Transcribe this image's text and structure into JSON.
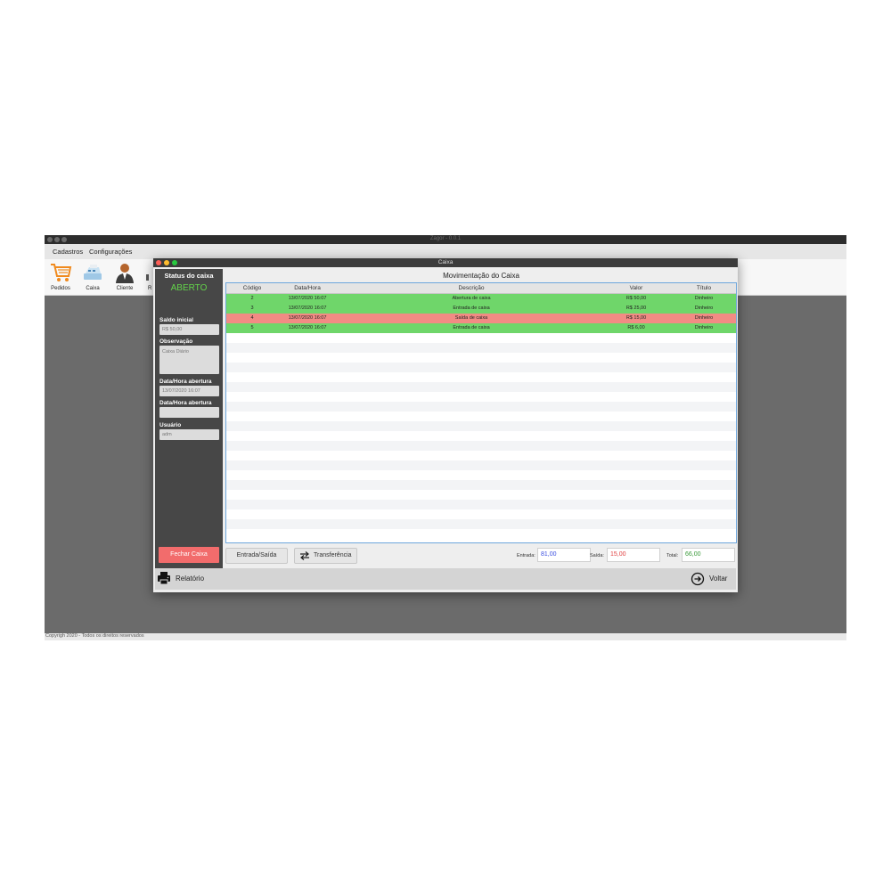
{
  "app": {
    "title": "Zagor - 0.0.1",
    "menu": [
      "Cadastros",
      "Configurações"
    ],
    "toolbar": [
      {
        "label": "Pedidos",
        "icon": "shopping-cart-icon"
      },
      {
        "label": "Caixa",
        "icon": "cash-register-icon"
      },
      {
        "label": "Cliente",
        "icon": "user-icon"
      }
    ],
    "partial_toolbar_label": "R",
    "copyright": "Copyrigh 2020 - Todos os direitos reservados"
  },
  "dialog": {
    "title": "Caixa",
    "side": {
      "status_label": "Status do caixa",
      "status_value": "ABERTO",
      "saldo_label": "Saldo inicial",
      "saldo_value": "R$ 50,00",
      "obs_label": "Observação",
      "obs_value": "Caixa Diário",
      "abertura_label": "Data/Hora abertura",
      "abertura_value": "13/07/2020 16:07",
      "fechamento_label": "Data/Hora abertura",
      "fechamento_value": "",
      "usuario_label": "Usuário",
      "usuario_value": "adm",
      "fechar_button": "Fechar Caixa"
    },
    "table": {
      "title": "Movimentação do Caixa",
      "columns": [
        "Código",
        "Data/Hora",
        "Descrição",
        "Valor",
        "Título"
      ],
      "rows": [
        {
          "codigo": "2",
          "data": "13/07/2020 16:07",
          "descricao": "Abertura de caixa",
          "valor": "R$ 50,00",
          "titulo": "Dinheiro",
          "color": "#6fd66a"
        },
        {
          "codigo": "3",
          "data": "13/07/2020 16:07",
          "descricao": "Entrada de caixa",
          "valor": "R$ 25,00",
          "titulo": "Dinheiro",
          "color": "#6fd66a"
        },
        {
          "codigo": "4",
          "data": "13/07/2020 16:07",
          "descricao": "Saída de caixa",
          "valor": "R$ 15,00",
          "titulo": "Dinheiro",
          "color": "#f28b84"
        },
        {
          "codigo": "5",
          "data": "13/07/2020 16:07",
          "descricao": "Entrada de caixa",
          "valor": "R$ 6,00",
          "titulo": "Dinheiro",
          "color": "#6fd66a"
        }
      ]
    },
    "buttons": {
      "entrada_saida": "Entrada/Saída",
      "transferencia": "Transferência"
    },
    "summary": {
      "entrada_label": "Entrada:",
      "entrada_value": "81,00",
      "saida_label": "Saída:",
      "saida_value": "15,00",
      "total_label": "Total:",
      "total_value": "66,00",
      "colors": {
        "entrada": "#3b4fe0",
        "saida": "#e04040",
        "total": "#3a9a3a"
      }
    },
    "footer": {
      "relatorio": "Relatório",
      "voltar": "Voltar"
    }
  }
}
